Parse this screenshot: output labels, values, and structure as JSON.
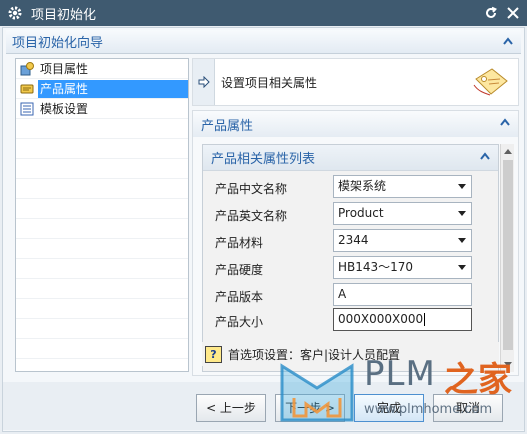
{
  "window": {
    "title": "项目初始化"
  },
  "wizard": {
    "heading": "项目初始化向导"
  },
  "tree": {
    "items": [
      {
        "label": "项目属性",
        "icon": "project-icon",
        "selected": false
      },
      {
        "label": "产品属性",
        "icon": "pencil-icon",
        "selected": true
      },
      {
        "label": "模板设置",
        "icon": "list-icon",
        "selected": false
      }
    ]
  },
  "step_header": {
    "text": "设置项目相关属性"
  },
  "product_section": {
    "title": "产品属性"
  },
  "attr_list": {
    "title": "产品相关属性列表",
    "rows": [
      {
        "label": "产品中文名称",
        "value": "模架系统",
        "type": "dropdown"
      },
      {
        "label": "产品英文名称",
        "value": "Product",
        "type": "dropdown"
      },
      {
        "label": "产品材料",
        "value": "2344",
        "type": "dropdown"
      },
      {
        "label": "产品硬度",
        "value": "HB143～170",
        "type": "dropdown"
      },
      {
        "label": "产品版本",
        "value": "A",
        "type": "text"
      },
      {
        "label": "产品大小",
        "value": "000X000X000",
        "type": "text"
      }
    ]
  },
  "hint": {
    "text": "首选项设置：客户|设计人员配置"
  },
  "buttons": {
    "back": "< 上一步",
    "next": "下一步 >",
    "finish": "完成",
    "cancel": "取消"
  },
  "watermark": {
    "brand": "PLM",
    "suffix": "之家",
    "url": "www.plmhome.com"
  },
  "colors": {
    "titlebar": "#3f5a70",
    "accent": "#2a64a8",
    "selection": "#3399ff",
    "watermark_orange": "#e06420"
  }
}
